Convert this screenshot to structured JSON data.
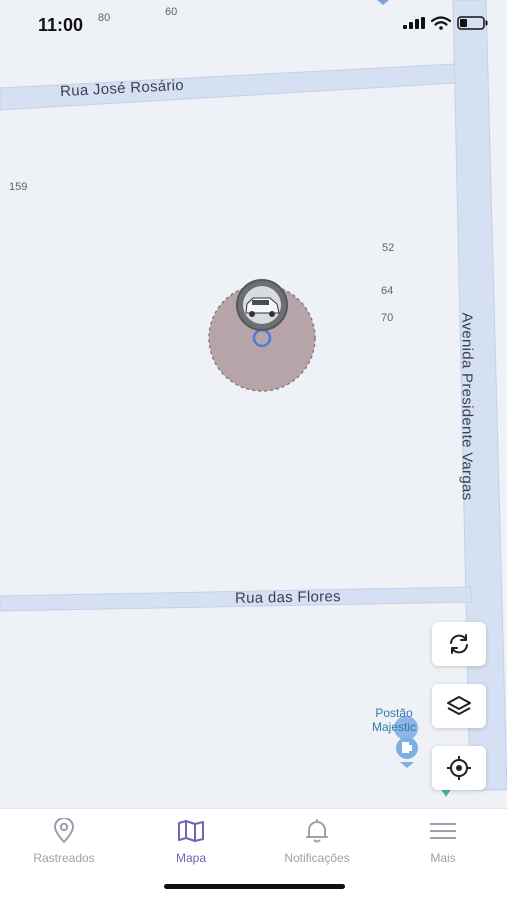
{
  "status_bar": {
    "time": "11:00",
    "icons": [
      "signal-icon",
      "wifi-icon",
      "battery-icon"
    ]
  },
  "map": {
    "roads": [
      {
        "name": "Rua José Rosário"
      },
      {
        "name": "Avenida Presidente Vargas"
      },
      {
        "name": "Rua das Flores"
      }
    ],
    "house_numbers": [
      "80",
      "60",
      "159",
      "52",
      "64",
      "70"
    ],
    "poi": {
      "name_line1": "Postão",
      "name_line2": "Majestic",
      "icon": "fuel-station-icon"
    },
    "tracked_vehicle": {
      "icon": "car-icon"
    }
  },
  "map_controls": [
    {
      "name": "refresh-button",
      "icon": "refresh-icon"
    },
    {
      "name": "layers-button",
      "icon": "layers-icon"
    },
    {
      "name": "my-location-button",
      "icon": "target-icon"
    }
  ],
  "tabbar": {
    "active_color": "#6f64b8",
    "inactive_color": "#9aa1ab",
    "tabs": [
      {
        "label": "Rastreados",
        "icon": "pin-icon",
        "active": false
      },
      {
        "label": "Mapa",
        "icon": "map-icon",
        "active": true
      },
      {
        "label": "Notificações",
        "icon": "bell-icon",
        "active": false
      },
      {
        "label": "Mais",
        "icon": "menu-icon",
        "active": false
      }
    ]
  }
}
